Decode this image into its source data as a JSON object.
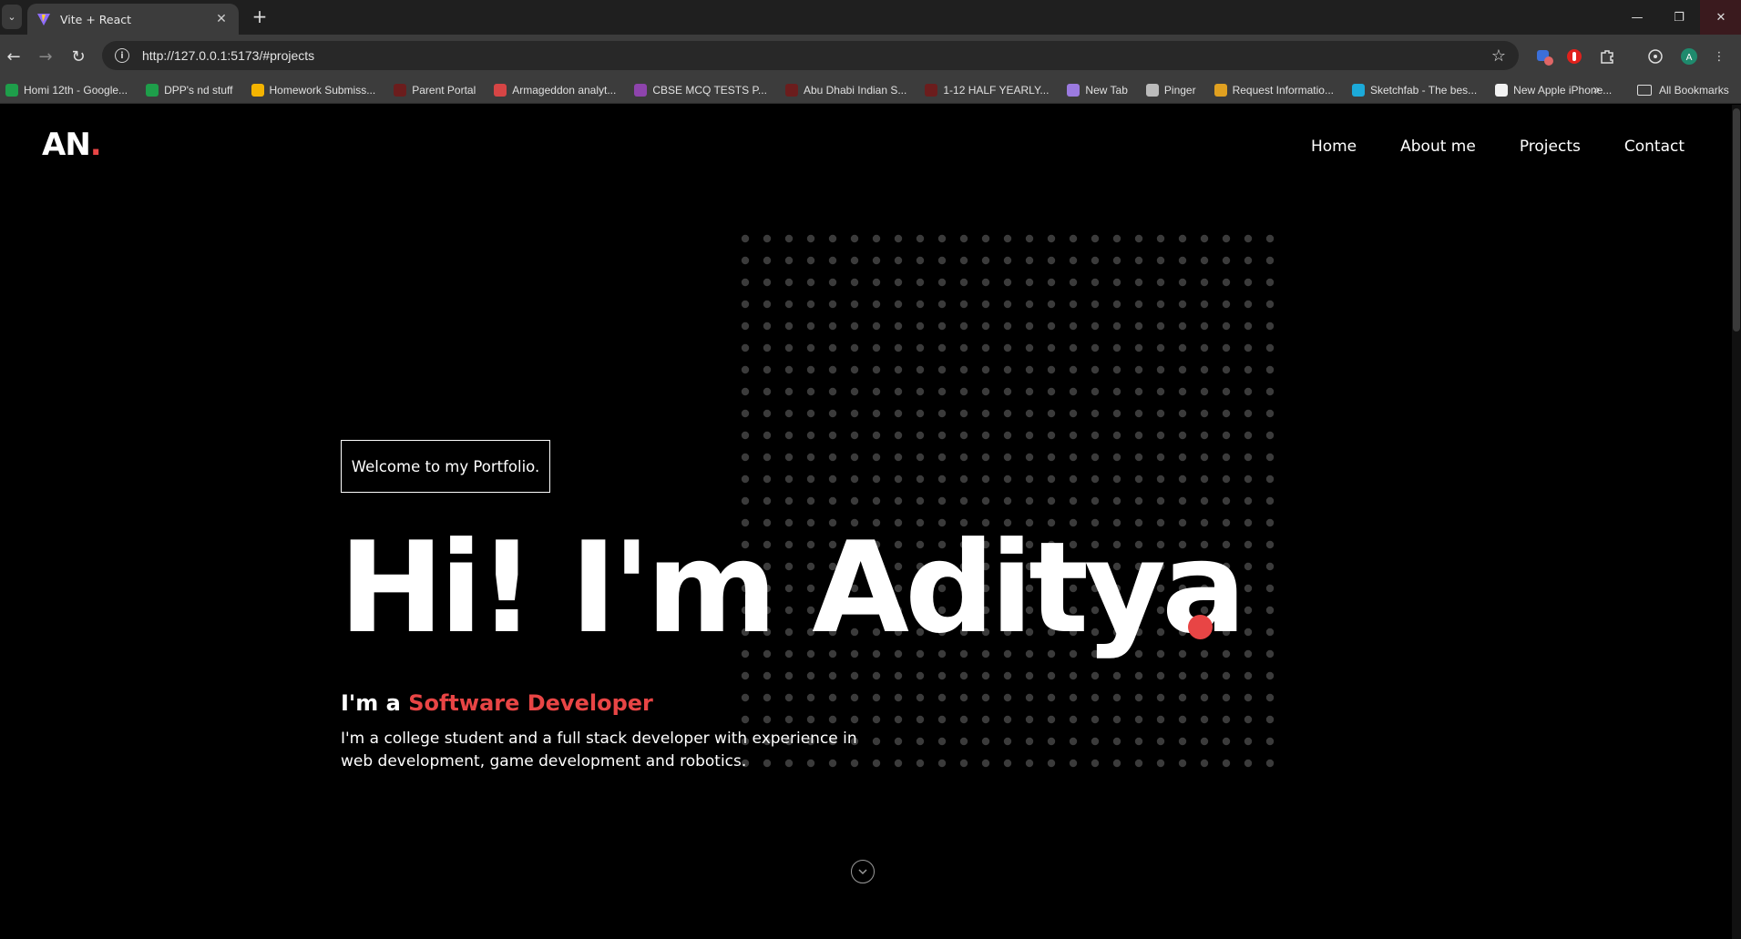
{
  "browser": {
    "tab": {
      "title": "Vite + React"
    },
    "address": {
      "url": "http://127.0.0.1:5173/#projects"
    },
    "bookmarks": [
      {
        "label": "Homi 12th - Google...",
        "color": "#1e9e4a"
      },
      {
        "label": "DPP's nd stuff",
        "color": "#1e9e4a"
      },
      {
        "label": "Homework Submiss...",
        "color": "#f4b400"
      },
      {
        "label": "Parent Portal",
        "color": "#6b1d1d"
      },
      {
        "label": "Armageddon analyt...",
        "color": "#d64545"
      },
      {
        "label": "CBSE MCQ TESTS P...",
        "color": "#8e44ad"
      },
      {
        "label": "Abu Dhabi Indian S...",
        "color": "#6b1d1d"
      },
      {
        "label": "1-12 HALF YEARLY...",
        "color": "#6b1d1d"
      },
      {
        "label": "New Tab",
        "color": "#9b7ae0"
      },
      {
        "label": "Pinger",
        "color": "#bbbbbb"
      },
      {
        "label": "Request Informatio...",
        "color": "#e0a020"
      },
      {
        "label": "Sketchfab - The bes...",
        "color": "#1caad9"
      },
      {
        "label": "New Apple iPhone...",
        "color": "#f2f2f2"
      }
    ],
    "all_bookmarks_label": "All Bookmarks"
  },
  "site": {
    "logo": {
      "text": "AN",
      "dot": "."
    },
    "nav": [
      "Home",
      "About me",
      "Projects",
      "Contact"
    ],
    "welcome": "Welcome to my Portfolio.",
    "hero": {
      "title": "Hi! I'm Aditya"
    },
    "role": {
      "prefix": "I'm a ",
      "highlight": "Software Developer"
    },
    "description": "I'm a college student and a full stack developer with experience in web development, game development and robotics.",
    "colors": {
      "accent": "#e84545",
      "background": "#000000",
      "text": "#ffffff"
    }
  }
}
